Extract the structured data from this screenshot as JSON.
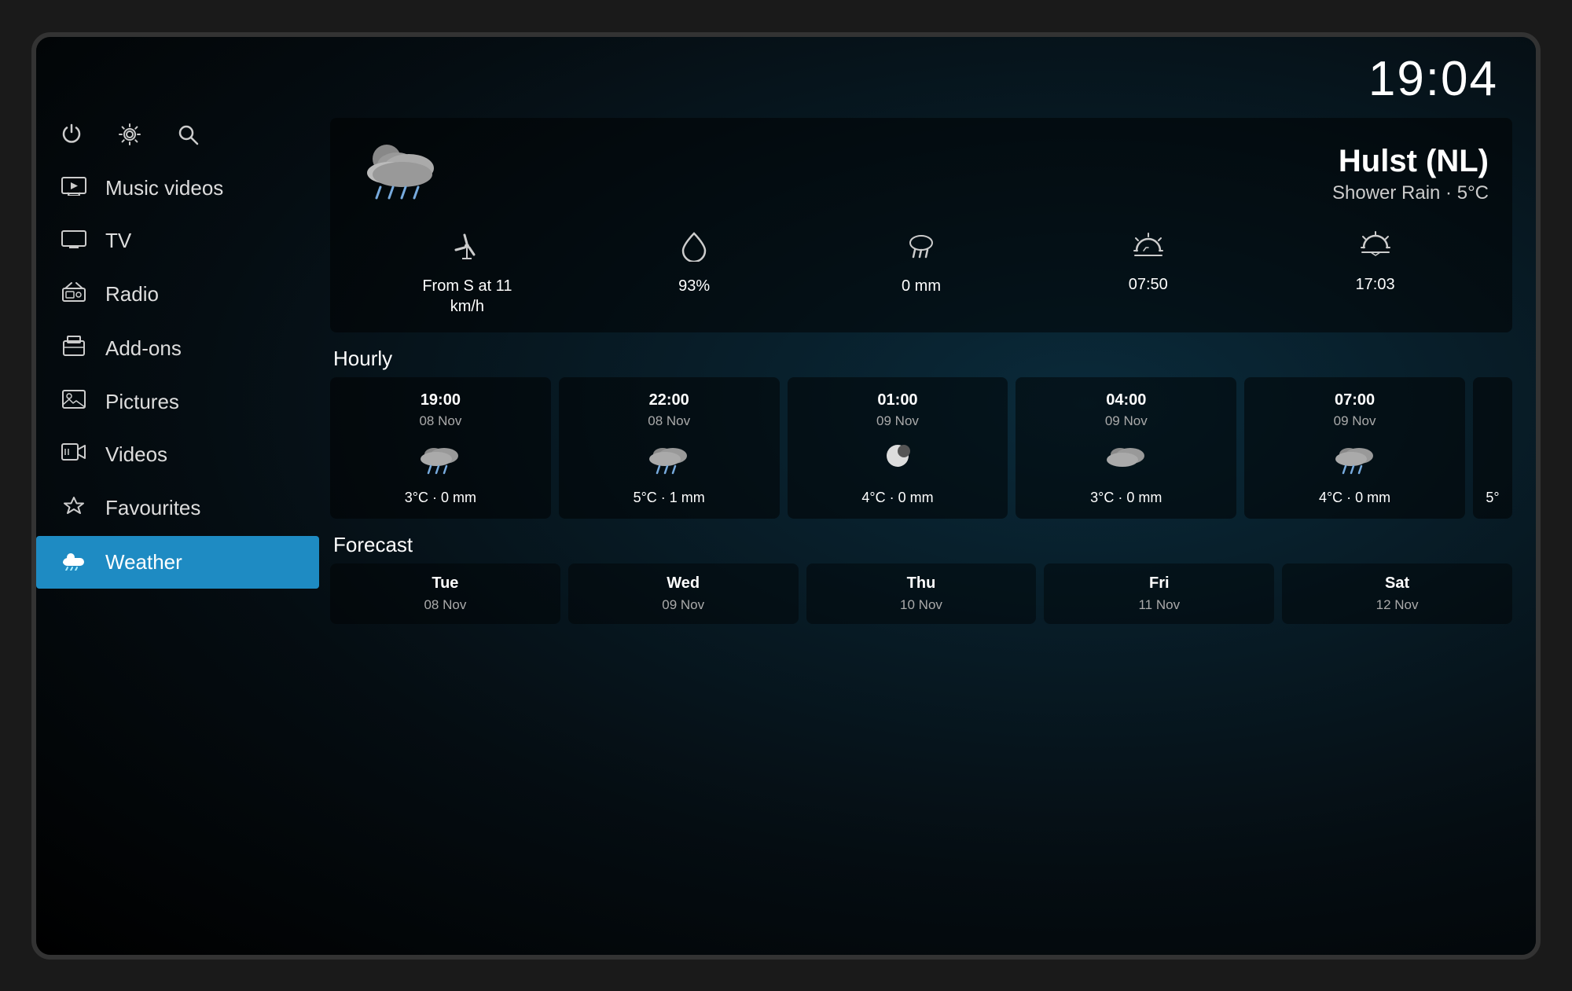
{
  "clock": "19:04",
  "sidebar": {
    "icons": [
      {
        "name": "power-icon",
        "symbol": "⏻"
      },
      {
        "name": "settings-icon",
        "symbol": "⚙"
      },
      {
        "name": "search-icon",
        "symbol": "🔍"
      }
    ],
    "nav_items": [
      {
        "id": "music-videos",
        "label": "Music videos",
        "icon": "🎬",
        "active": false
      },
      {
        "id": "tv",
        "label": "TV",
        "icon": "📺",
        "active": false
      },
      {
        "id": "radio",
        "label": "Radio",
        "icon": "📻",
        "active": false
      },
      {
        "id": "add-ons",
        "label": "Add-ons",
        "icon": "📦",
        "active": false
      },
      {
        "id": "pictures",
        "label": "Pictures",
        "icon": "🖼",
        "active": false
      },
      {
        "id": "videos",
        "label": "Videos",
        "icon": "🎞",
        "active": false
      },
      {
        "id": "favourites",
        "label": "Favourites",
        "icon": "⭐",
        "active": false
      },
      {
        "id": "weather",
        "label": "Weather",
        "icon": "⛅",
        "active": true
      }
    ]
  },
  "weather": {
    "location": "Hulst (NL)",
    "condition": "Shower Rain · 5°C",
    "details": [
      {
        "icon": "wind",
        "value": "From S at 11\nkm/h"
      },
      {
        "icon": "humidity",
        "value": "93%"
      },
      {
        "icon": "rain",
        "value": "0 mm"
      },
      {
        "icon": "sunrise",
        "value": "07:50"
      },
      {
        "icon": "sunset",
        "value": "17:03"
      }
    ],
    "hourly_title": "Hourly",
    "hourly": [
      {
        "time": "19:00",
        "date": "08 Nov",
        "temp": "3°C · 0 mm"
      },
      {
        "time": "22:00",
        "date": "08 Nov",
        "temp": "5°C · 1 mm"
      },
      {
        "time": "01:00",
        "date": "09 Nov",
        "temp": "4°C · 0 mm"
      },
      {
        "time": "04:00",
        "date": "09 Nov",
        "temp": "3°C · 0 mm"
      },
      {
        "time": "07:00",
        "date": "09 Nov",
        "temp": "4°C · 0 mm"
      }
    ],
    "hourly_partial_temp": "5°",
    "forecast_title": "Forecast",
    "forecast": [
      {
        "day": "Tue",
        "date": "08 Nov"
      },
      {
        "day": "Wed",
        "date": "09 Nov"
      },
      {
        "day": "Thu",
        "date": "10 Nov"
      },
      {
        "day": "Fri",
        "date": "11 Nov"
      },
      {
        "day": "Sat",
        "date": "12 Nov"
      }
    ]
  }
}
